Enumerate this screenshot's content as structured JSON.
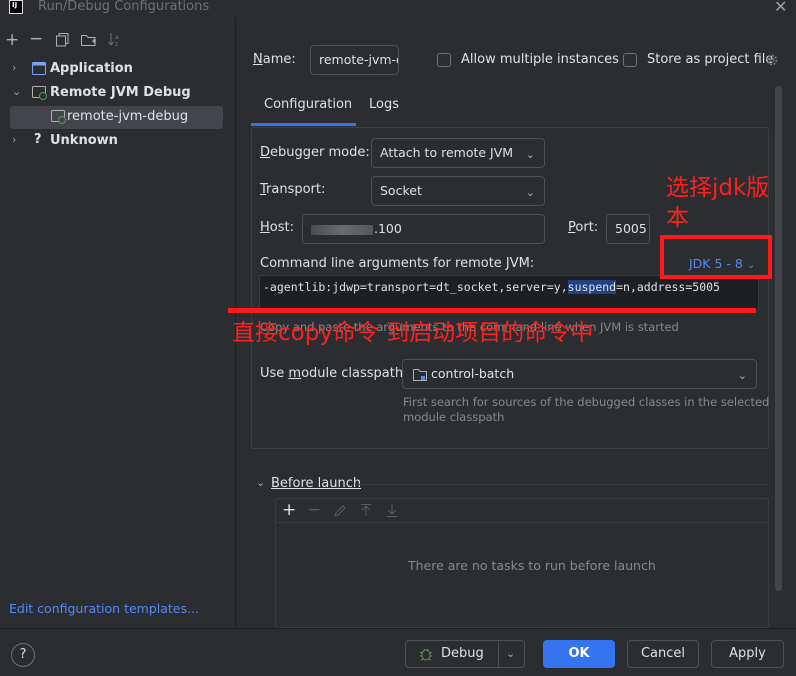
{
  "window": {
    "title": "Run/Debug Configurations",
    "logo_text": "IJ",
    "close": "✕"
  },
  "left_toolbar": {
    "add": "+",
    "remove": "−",
    "copy": "⧉",
    "new_folder": "⊞",
    "sort": "↓ᵃ"
  },
  "tree": [
    {
      "label": "Application",
      "expanded": false,
      "chevron": "›"
    },
    {
      "label": "Remote JVM Debug",
      "expanded": true,
      "chevron": "⌄"
    },
    {
      "label": "remote-jvm-debug",
      "selected": true
    },
    {
      "label": "Unknown",
      "expanded": false,
      "chevron": "›",
      "icon": "?"
    }
  ],
  "edit_templates_link": "Edit configuration templates...",
  "form": {
    "name_label_u": "N",
    "name_label_rest": "ame:",
    "name_value": "remote-jvm-d",
    "allow_multiple": "Allow multiple instances",
    "store_project": "Store as project file",
    "tabs": [
      {
        "label": "Configuration",
        "active": true
      },
      {
        "label": "Logs",
        "active": false
      }
    ],
    "debugger_mode_label_u": "D",
    "debugger_mode_label_rest": "ebugger mode:",
    "debugger_mode_value": "Attach to remote JVM",
    "transport_label_u": "T",
    "transport_label_rest": "ransport:",
    "transport_value": "Socket",
    "host_label_u": "H",
    "host_label_rest": "ost:",
    "host_value": ".100",
    "port_label_u": "P",
    "port_label_rest": "ort:",
    "port_value": "5005",
    "cmd_label": "Command line arguments for remote JVM:",
    "jdk_link": "JDK 5 - 8",
    "cmd_before": "-agentlib:jdwp=transport=dt_socket,server=y,",
    "cmd_selected": "suspend",
    "cmd_after": "=n,address=5005",
    "cmd_hint": "Copy and paste the arguments to the command line when JVM is started",
    "module_label_pre": "Use ",
    "module_label_u": "m",
    "module_label_rest": "odule classpath:",
    "module_value": "control-batch",
    "module_hint_line1": "First search for sources of the debugged classes in the selected",
    "module_hint_line2": "module classpath",
    "before_launch_label": "Before launch",
    "before_launch_empty": "There are no tasks to run before launch"
  },
  "buttons": {
    "help": "?",
    "debug": "Debug",
    "ok": "OK",
    "cancel": "Cancel",
    "apply": "Apply"
  },
  "annotations": {
    "jdk_note_line1": "选择jdk版",
    "jdk_note_line2": "本",
    "copy_note": "直接copy命令 到启动项目的命令中",
    "color": "#ff1a1a"
  }
}
